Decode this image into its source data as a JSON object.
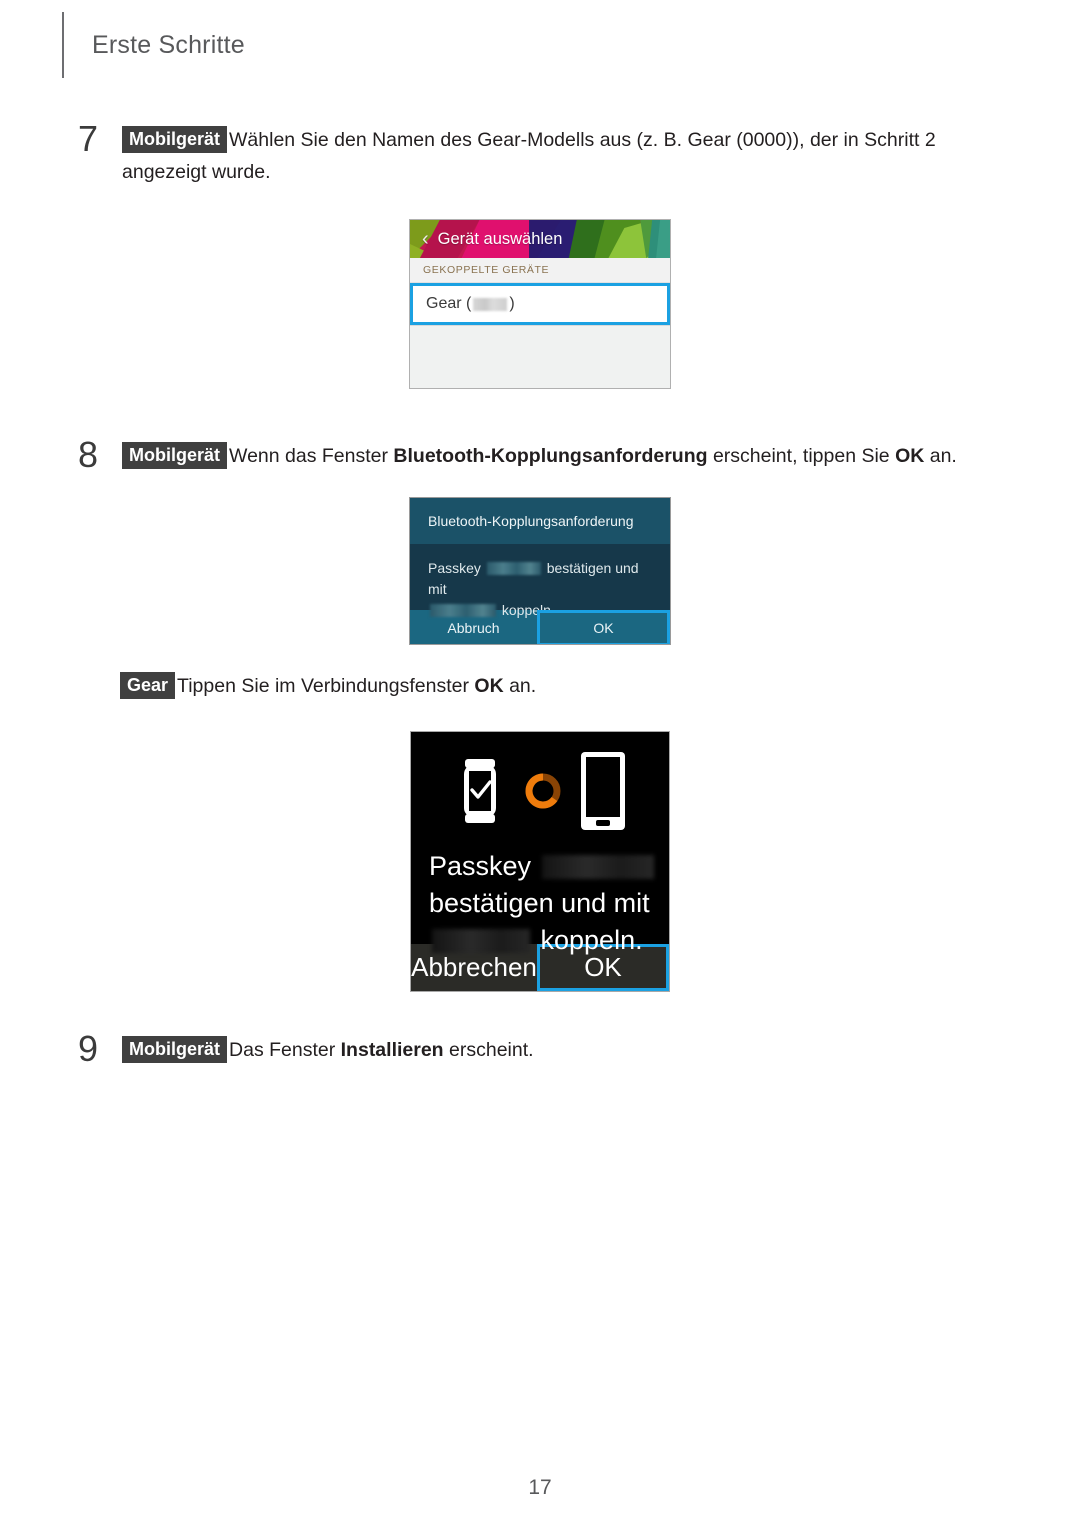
{
  "document": {
    "chapter_title": "Erste Schritte",
    "page_number": "17"
  },
  "steps": [
    {
      "number": "7",
      "tag": "Mobilgerät",
      "text_before": "Wählen Sie den Namen des Gear-Modells aus (z. B. Gear (0000)), der in Schritt 2 angezeigt wurde."
    },
    {
      "number": "8",
      "tag": "Mobilgerät",
      "text_1": "Wenn das Fenster ",
      "bold_1": "Bluetooth-Kopplungsanforderung",
      "text_2": " erscheint, tippen Sie ",
      "bold_2": "OK",
      "text_3": " an."
    },
    {
      "number": "",
      "tag": "Gear",
      "text_1": "Tippen Sie im Verbindungsfenster ",
      "bold_1": "OK",
      "text_2": " an."
    },
    {
      "number": "9",
      "tag": "Mobilgerät",
      "text_1": "Das Fenster ",
      "bold_1": "Installieren",
      "text_2": " erscheint."
    }
  ],
  "screenshot_device_select": {
    "name": "geraet-auswaehlen",
    "header_title": "Gerät auswählen",
    "back_icon": "chevron-left-icon",
    "section_label": "GEKOPPELTE GERÄTE",
    "list_item_label": "Gear (",
    "list_item_label_end": ")",
    "highlight_color": "#1ba1e2",
    "header_colors": [
      "#8f1d43",
      "#c2184f",
      "#e01f6e",
      "#2b1b6e",
      "#3d7a1e",
      "#76b52a",
      "#9cc832",
      "#2e8f7a"
    ]
  },
  "screenshot_bluetooth_dialog": {
    "name": "bluetooth-kopplungsanforderung",
    "title": "Bluetooth-Kopplungsanforderung",
    "body_text_1": "Passkey ",
    "body_text_2": " bestätigen und mit ",
    "body_text_3": " koppeln.",
    "cancel_label": "Abbruch",
    "ok_label": "OK",
    "title_bg": "#1b5268",
    "body_bg": "#16384a",
    "actions_bg": "#1b6781",
    "highlight_color": "#1ba1e2"
  },
  "screenshot_gear_watch": {
    "name": "gear-verbindungsfenster",
    "icons": [
      "watch-check-icon",
      "orange-progress-ring-icon",
      "phone-icon"
    ],
    "accent_color": "#e8760d",
    "body_text_1": "Passkey ",
    "body_text_2": "bestätigen und mit",
    "body_text_3": " koppeln.",
    "cancel_label": "Abbrechen",
    "ok_label": "OK",
    "background": "#000000",
    "button_bg": "#2b2b27",
    "highlight_color": "#1ba1e2"
  }
}
